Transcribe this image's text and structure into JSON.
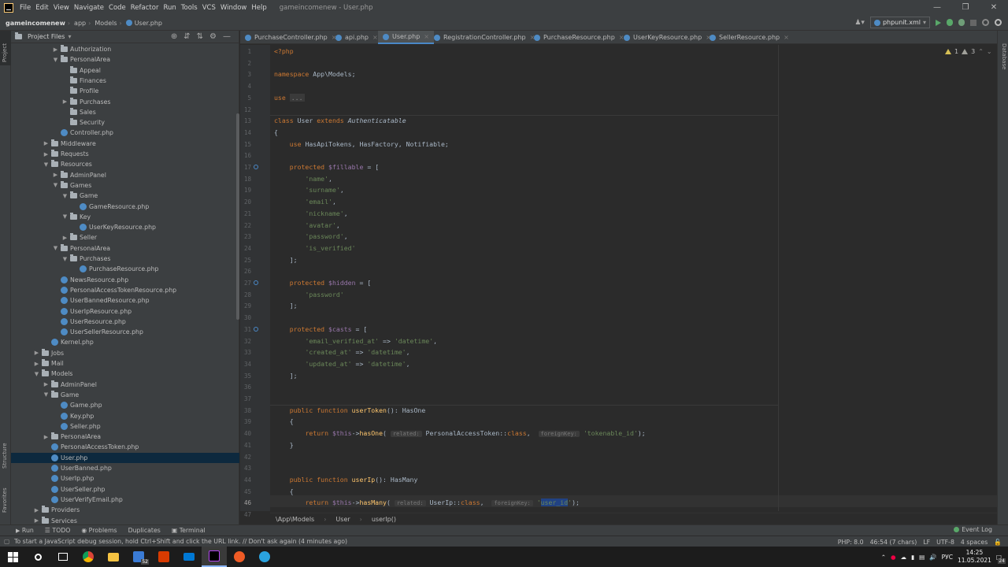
{
  "menu": [
    "File",
    "Edit",
    "View",
    "Navigate",
    "Code",
    "Refactor",
    "Run",
    "Tools",
    "VCS",
    "Window",
    "Help"
  ],
  "window_title": "gameincomenew - User.php",
  "window_controls": [
    "—",
    "❐",
    "✕"
  ],
  "navbar": {
    "crumbs": [
      "gameincomenew",
      "app",
      "Models",
      "User.php"
    ],
    "run_config": "phpunit.xml"
  },
  "left_strip": {
    "project": "Project",
    "structure": "Structure",
    "favorites": "Favorites"
  },
  "right_strip": {
    "database": "Database"
  },
  "project_panel": {
    "title": "Project Files",
    "tree": [
      {
        "label": "Authorization",
        "depth": 4,
        "type": "folder",
        "arrow": "▶"
      },
      {
        "label": "PersonalArea",
        "depth": 4,
        "type": "folder",
        "arrow": "▼"
      },
      {
        "label": "Appeal",
        "depth": 5,
        "type": "folder",
        "arrow": ""
      },
      {
        "label": "Finances",
        "depth": 5,
        "type": "folder",
        "arrow": ""
      },
      {
        "label": "Profile",
        "depth": 5,
        "type": "folder",
        "arrow": ""
      },
      {
        "label": "Purchases",
        "depth": 5,
        "type": "folder",
        "arrow": "▶"
      },
      {
        "label": "Sales",
        "depth": 5,
        "type": "folder",
        "arrow": ""
      },
      {
        "label": "Security",
        "depth": 5,
        "type": "folder",
        "arrow": ""
      },
      {
        "label": "Controller.php",
        "depth": 4,
        "type": "php",
        "arrow": ""
      },
      {
        "label": "Middleware",
        "depth": 3,
        "type": "folder",
        "arrow": "▶"
      },
      {
        "label": "Requests",
        "depth": 3,
        "type": "folder",
        "arrow": "▶"
      },
      {
        "label": "Resources",
        "depth": 3,
        "type": "folder",
        "arrow": "▼"
      },
      {
        "label": "AdminPanel",
        "depth": 4,
        "type": "folder",
        "arrow": "▶"
      },
      {
        "label": "Games",
        "depth": 4,
        "type": "folder",
        "arrow": "▼"
      },
      {
        "label": "Game",
        "depth": 5,
        "type": "folder",
        "arrow": "▼"
      },
      {
        "label": "GameResource.php",
        "depth": 6,
        "type": "php",
        "arrow": ""
      },
      {
        "label": "Key",
        "depth": 5,
        "type": "folder",
        "arrow": "▼"
      },
      {
        "label": "UserKeyResource.php",
        "depth": 6,
        "type": "php",
        "arrow": ""
      },
      {
        "label": "Seller",
        "depth": 5,
        "type": "folder",
        "arrow": "▶"
      },
      {
        "label": "PersonalArea",
        "depth": 4,
        "type": "folder",
        "arrow": "▼"
      },
      {
        "label": "Purchases",
        "depth": 5,
        "type": "folder",
        "arrow": "▼"
      },
      {
        "label": "PurchaseResource.php",
        "depth": 6,
        "type": "php",
        "arrow": ""
      },
      {
        "label": "NewsResource.php",
        "depth": 4,
        "type": "php",
        "arrow": ""
      },
      {
        "label": "PersonalAccessTokenResource.php",
        "depth": 4,
        "type": "php",
        "arrow": ""
      },
      {
        "label": "UserBannedResource.php",
        "depth": 4,
        "type": "php",
        "arrow": ""
      },
      {
        "label": "UserIpResource.php",
        "depth": 4,
        "type": "php",
        "arrow": ""
      },
      {
        "label": "UserResource.php",
        "depth": 4,
        "type": "php",
        "arrow": ""
      },
      {
        "label": "UserSellerResource.php",
        "depth": 4,
        "type": "php",
        "arrow": ""
      },
      {
        "label": "Kernel.php",
        "depth": 3,
        "type": "php",
        "arrow": ""
      },
      {
        "label": "Jobs",
        "depth": 2,
        "type": "folder",
        "arrow": "▶"
      },
      {
        "label": "Mail",
        "depth": 2,
        "type": "folder",
        "arrow": "▶"
      },
      {
        "label": "Models",
        "depth": 2,
        "type": "folder",
        "arrow": "▼"
      },
      {
        "label": "AdminPanel",
        "depth": 3,
        "type": "folder",
        "arrow": "▶"
      },
      {
        "label": "Game",
        "depth": 3,
        "type": "folder",
        "arrow": "▼"
      },
      {
        "label": "Game.php",
        "depth": 4,
        "type": "php",
        "arrow": ""
      },
      {
        "label": "Key.php",
        "depth": 4,
        "type": "php",
        "arrow": ""
      },
      {
        "label": "Seller.php",
        "depth": 4,
        "type": "php",
        "arrow": ""
      },
      {
        "label": "PersonalArea",
        "depth": 3,
        "type": "folder",
        "arrow": "▶"
      },
      {
        "label": "PersonalAccessToken.php",
        "depth": 3,
        "type": "php",
        "arrow": ""
      },
      {
        "label": "User.php",
        "depth": 3,
        "type": "php",
        "arrow": "",
        "selected": true
      },
      {
        "label": "UserBanned.php",
        "depth": 3,
        "type": "php",
        "arrow": ""
      },
      {
        "label": "UserIp.php",
        "depth": 3,
        "type": "php",
        "arrow": ""
      },
      {
        "label": "UserSeller.php",
        "depth": 3,
        "type": "php",
        "arrow": ""
      },
      {
        "label": "UserVerifyEmail.php",
        "depth": 3,
        "type": "php",
        "arrow": ""
      },
      {
        "label": "Providers",
        "depth": 2,
        "type": "folder",
        "arrow": "▶"
      },
      {
        "label": "Services",
        "depth": 2,
        "type": "folder",
        "arrow": "▶"
      }
    ]
  },
  "tabs": [
    {
      "label": "PurchaseController.php",
      "active": false
    },
    {
      "label": "api.php",
      "active": false
    },
    {
      "label": "User.php",
      "active": true
    },
    {
      "label": "RegistrationController.php",
      "active": false
    },
    {
      "label": "PurchaseResource.php",
      "active": false
    },
    {
      "label": "UserKeyResource.php",
      "active": false
    },
    {
      "label": "SellerResource.php",
      "active": false
    }
  ],
  "inspections": {
    "warnings": "1",
    "weak_warnings": "3"
  },
  "code": {
    "current_line": 46,
    "lines": [
      {
        "n": 1,
        "html": "<span class='kw'>&lt;?php</span>"
      },
      {
        "n": 2,
        "html": ""
      },
      {
        "n": 3,
        "html": "<span class='kw'>namespace</span> App\\Models;"
      },
      {
        "n": 4,
        "html": ""
      },
      {
        "n": 5,
        "html": "<span class='kw'>use</span> <span class='fold'>...</span>"
      },
      {
        "n": 12,
        "html": ""
      },
      {
        "n": 13,
        "html": "<span class='kw'>class</span> User <span class='kw'>extends</span> <span class='it'>Authenticatable</span>"
      },
      {
        "n": 14,
        "html": "{"
      },
      {
        "n": 15,
        "html": "    <span class='kw'>use</span> HasApiTokens, HasFactory, Notifiable;"
      },
      {
        "n": 16,
        "html": ""
      },
      {
        "n": 17,
        "html": "    <span class='kw'>protected</span> <span class='var'>$fillable</span> = ["
      },
      {
        "n": 18,
        "html": "        <span class='str'>'name'</span>,"
      },
      {
        "n": 19,
        "html": "        <span class='str'>'surname'</span>,"
      },
      {
        "n": 20,
        "html": "        <span class='str'>'email'</span>,"
      },
      {
        "n": 21,
        "html": "        <span class='str'>'nickname'</span>,"
      },
      {
        "n": 22,
        "html": "        <span class='str'>'avatar'</span>,"
      },
      {
        "n": 23,
        "html": "        <span class='str'>'password'</span>,"
      },
      {
        "n": 24,
        "html": "        <span class='str'>'is_verified'</span>"
      },
      {
        "n": 25,
        "html": "    ];"
      },
      {
        "n": 26,
        "html": ""
      },
      {
        "n": 27,
        "html": "    <span class='kw'>protected</span> <span class='var'>$hidden</span> = ["
      },
      {
        "n": 28,
        "html": "        <span class='str'>'password'</span>"
      },
      {
        "n": 29,
        "html": "    ];"
      },
      {
        "n": 30,
        "html": ""
      },
      {
        "n": 31,
        "html": "    <span class='kw'>protected</span> <span class='var'>$casts</span> = ["
      },
      {
        "n": 32,
        "html": "        <span class='str'>'email_verified_at'</span> =&gt; <span class='str'>'datetime'</span>,"
      },
      {
        "n": 33,
        "html": "        <span class='str'>'created_at'</span> =&gt; <span class='str'>'datetime'</span>,"
      },
      {
        "n": 34,
        "html": "        <span class='str'>'updated_at'</span> =&gt; <span class='str'>'datetime'</span>,"
      },
      {
        "n": 35,
        "html": "    ];"
      },
      {
        "n": 36,
        "html": ""
      },
      {
        "n": 37,
        "html": ""
      },
      {
        "n": 38,
        "html": "    <span class='kw'>public function</span> <span class='fn'>userToken</span>(): HasOne"
      },
      {
        "n": 39,
        "html": "    {"
      },
      {
        "n": 40,
        "html": "        <span class='kw'>return</span> <span class='var'>$this</span>-&gt;<span class='fn'>hasOne</span>( <span class='hint'>related:</span> PersonalAccessToken::<span class='kw'>class</span>,  <span class='hint'>foreignKey:</span> <span class='str'>'tokenable_id'</span>);"
      },
      {
        "n": 41,
        "html": "    }"
      },
      {
        "n": 42,
        "html": ""
      },
      {
        "n": 43,
        "html": ""
      },
      {
        "n": 44,
        "html": "    <span class='kw'>public function</span> <span class='fn'>userIp</span>(): HasMany"
      },
      {
        "n": 45,
        "html": "    {"
      },
      {
        "n": 46,
        "html": "        <span class='kw'>return</span> <span class='var'>$this</span>-&gt;<span class='fn'>hasMany</span>( <span class='hint'>related:</span> UserIp::<span class='kw'>class</span>,  <span class='hint'>foreignKey:</span> <span class='str'>'<span class='sel'>user_id</span>'</span>);"
      },
      {
        "n": 47,
        "html": "    }"
      }
    ]
  },
  "editor_breadcrumbs": [
    "\\App\\Models",
    "User",
    "userIp()"
  ],
  "tool_windows": [
    "Run",
    "TODO",
    "Problems",
    "Duplicates",
    "Terminal"
  ],
  "event_log": "Event Log",
  "status": {
    "message": "To start a JavaScript debug session, hold Ctrl+Shift and click the URL link. // Don't ask again (4 minutes ago)",
    "php": "PHP: 8.0",
    "position": "46:54 (7 chars)",
    "line_sep": "LF",
    "encoding": "UTF-8",
    "indent": "4 spaces"
  },
  "taskbar": {
    "badge": "52",
    "lang": "РУС",
    "time": "14:25",
    "date": "11.05.2021",
    "notif_count": "24"
  }
}
